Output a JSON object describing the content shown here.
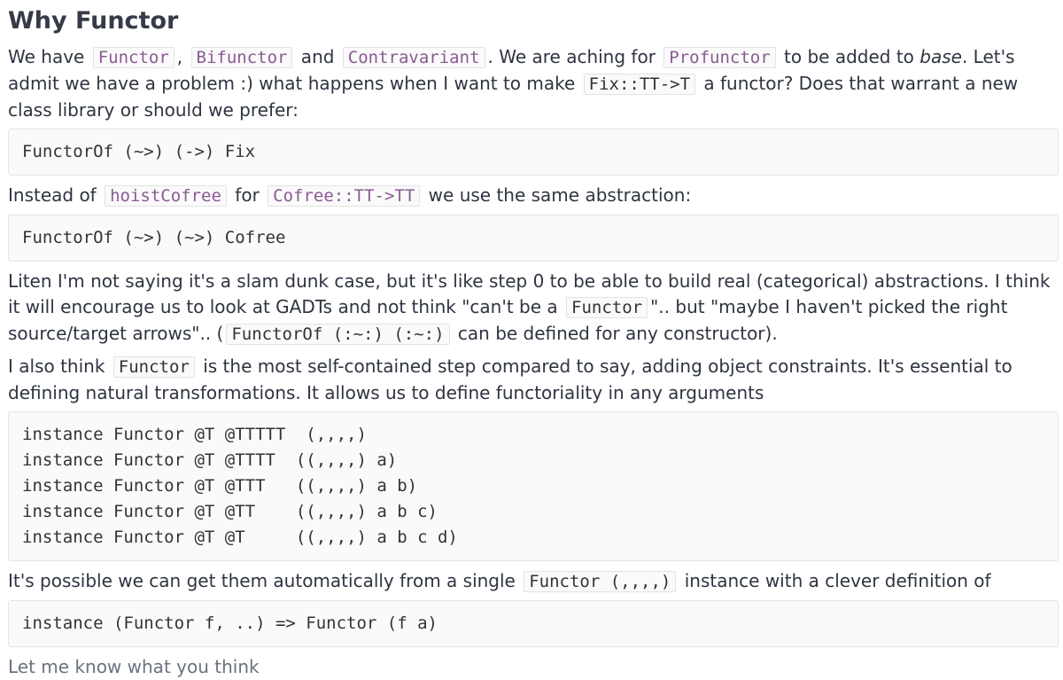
{
  "title": "Why Functor",
  "p1": {
    "t1": "We have ",
    "c1": "Functor",
    "t2": ", ",
    "c2": "Bifunctor",
    "t3": " and ",
    "c3": "Contravariant",
    "t4": ". We are aching for ",
    "c4": "Profunctor",
    "t5": " to be added to ",
    "em": "base",
    "t6": ". Let's admit we have a problem :) what happens when I want to make ",
    "c5": "Fix::TT->T",
    "t7": " a functor? Does that warrant a new class library or should we prefer:"
  },
  "code1": "FunctorOf (~>) (->) Fix",
  "p2": {
    "t1": "Instead of ",
    "c1": "hoistCofree",
    "t2": " for ",
    "c2": "Cofree::TT->TT",
    "t3": " we use the same abstraction:"
  },
  "code2": "FunctorOf (~>) (~>) Cofree",
  "p3": {
    "t1": "Liten I'm not saying it's a slam dunk case, but it's like step 0 to be able to build real (categorical) abstractions. I think it will encourage us to look at GADTs and not think \"can't be a ",
    "c1": "Functor",
    "t2": "\".. but \"maybe I haven't picked the right source/target arrows\".. (",
    "c2": "FunctorOf (:~:) (:~:)",
    "t3": " can be defined for any constructor)."
  },
  "p4": {
    "t1": "I also think ",
    "c1": "Functor",
    "t2": " is the most self-contained step compared to say, adding object constraints. It's essential to defining natural transformations. It allows us to define functoriality in any arguments"
  },
  "code3": "instance Functor @T @TTTTT  (,,,,)\ninstance Functor @T @TTTT  ((,,,,) a)\ninstance Functor @T @TTT   ((,,,,) a b)\ninstance Functor @T @TT    ((,,,,) a b c)\ninstance Functor @T @T     ((,,,,) a b c d)",
  "p5": {
    "t1": "It's possible we can get them automatically from a single ",
    "c1": "Functor (,,,,)",
    "t2": " instance with a clever definition of"
  },
  "code4": "instance (Functor f, ..) => Functor (f a)",
  "p6": "Let me know what you think"
}
